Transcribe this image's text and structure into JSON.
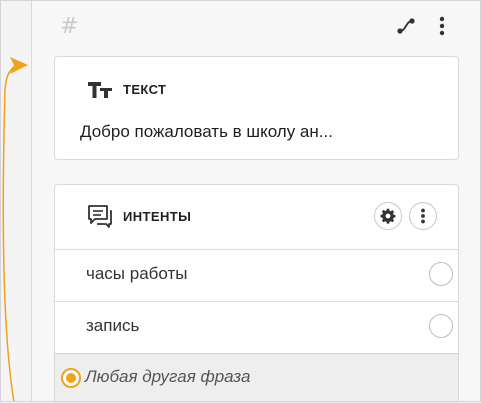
{
  "colors": {
    "accent": "#f0a21a",
    "card_border": "#d9d9d9",
    "icon": "#333333"
  },
  "node": {
    "hash_symbol": "#",
    "actions": [
      {
        "icon": "connection-route-icon"
      },
      {
        "icon": "kebab-menu-icon"
      }
    ]
  },
  "text_block": {
    "title": "ТЕКСТ",
    "icon": "text-type-icon",
    "preview": "Добро пожаловать в школу ан..."
  },
  "intents_block": {
    "title": "ИНТЕНТЫ",
    "icon": "chat-bubble-icon",
    "actions": [
      {
        "icon": "gear-icon"
      },
      {
        "icon": "kebab-menu-icon"
      }
    ],
    "items": [
      {
        "label": "часы работы"
      },
      {
        "label": "запись"
      }
    ],
    "fallback_label": "Любая другая фраза"
  }
}
